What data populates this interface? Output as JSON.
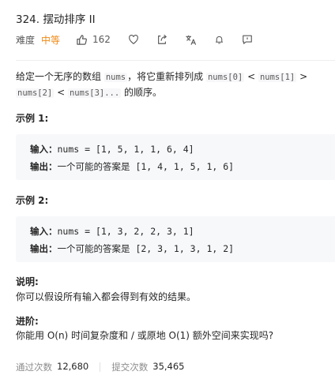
{
  "problem": {
    "title": "324. 摆动排序 II",
    "difficulty_label": "难度",
    "difficulty": "中等",
    "likes": "162"
  },
  "description": {
    "p1": "给定一个无序的数组",
    "nums": "nums",
    "p2": "，将它重新排列成",
    "c1": "nums[0]",
    "lt": "<",
    "c2": "nums[1]",
    "gt": ">",
    "c3": "nums[2]",
    "c4": "nums[3]...",
    "p3": "的顺序。"
  },
  "examples": [
    {
      "heading": "示例 1:",
      "input_label": "输入：",
      "input": "nums = [1, 5, 1, 1, 6, 4]",
      "output_label": "输出：",
      "output_text": "一个可能的答案是",
      "output": "[1, 4, 1, 5, 1, 6]"
    },
    {
      "heading": "示例 2:",
      "input_label": "输入：",
      "input": "nums = [1, 3, 2, 2, 3, 1]",
      "output_label": "输出：",
      "output_text": "一个可能的答案是",
      "output": "[2, 3, 1, 3, 1, 2]"
    }
  ],
  "note": {
    "heading": "说明:",
    "text": "你可以假设所有输入都会得到有效的结果。"
  },
  "advanced": {
    "heading": "进阶:",
    "text": "你能用 O(n) 时间复杂度和 / 或原地 O(1) 额外空间来实现吗?"
  },
  "footer": {
    "accepted_label": "通过次数",
    "accepted": "12,680",
    "submissions_label": "提交次数",
    "submissions": "35,465"
  },
  "colors": {
    "difficulty": "#ef8a18",
    "code_bg": "#f7f8fa"
  },
  "icons": [
    "thumbs-up-icon",
    "heart-icon",
    "share-icon",
    "translate-icon",
    "bell-icon",
    "feedback-icon"
  ]
}
